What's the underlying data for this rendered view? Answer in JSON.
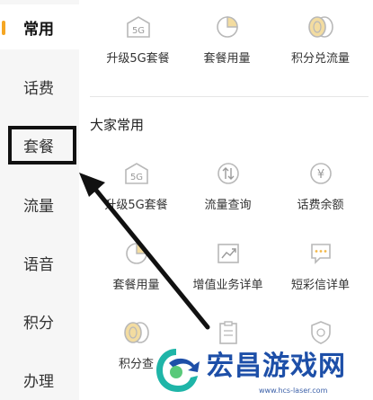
{
  "sidebar": {
    "items": [
      {
        "label": "常用",
        "active": true
      },
      {
        "label": "话费"
      },
      {
        "label": "套餐"
      },
      {
        "label": "流量"
      },
      {
        "label": "语音"
      },
      {
        "label": "积分"
      },
      {
        "label": "办理"
      }
    ]
  },
  "top_row": [
    {
      "label": "升级5G套餐",
      "icon": "5g-icon"
    },
    {
      "label": "套餐用量",
      "icon": "pie-chart-icon"
    },
    {
      "label": "积分兑流量",
      "icon": "coins-icon"
    }
  ],
  "section": {
    "title": "大家常用",
    "items": [
      {
        "label": "升级5G套餐",
        "icon": "5g-icon"
      },
      {
        "label": "流量查询",
        "icon": "data-exchange-icon"
      },
      {
        "label": "话费余额",
        "icon": "yuan-coin-icon"
      },
      {
        "label": "套餐用量",
        "icon": "pie-chart-icon"
      },
      {
        "label": "增值业务详单",
        "icon": "trend-chart-icon"
      },
      {
        "label": "短彩信详单",
        "icon": "message-icon"
      },
      {
        "label": "积分查",
        "icon": "coins-icon"
      },
      {
        "label": "",
        "icon": "clipboard-icon"
      },
      {
        "label": "",
        "icon": "shield-icon"
      }
    ]
  },
  "watermark": {
    "title": "宏昌游戏网",
    "url": "www.hcs-laser.com"
  },
  "colors": {
    "accent": "#f5a623",
    "icon_stroke": "#b8b8b8",
    "icon_fill": "#f3dca0",
    "watermark_blue": "#1d4fa8"
  }
}
